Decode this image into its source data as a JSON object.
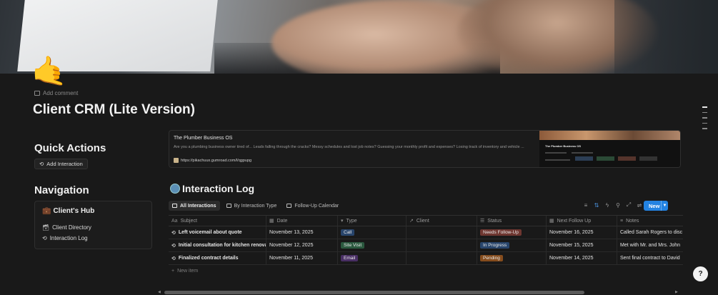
{
  "page": {
    "icon": "🤙",
    "add_comment": "Add comment",
    "title": "Client CRM (Lite Version)"
  },
  "quick_actions": {
    "heading": "Quick Actions",
    "button_label": "Add Interaction"
  },
  "navigation": {
    "heading": "Navigation",
    "hub_icon": "💼",
    "hub_label": "Client's Hub",
    "items": [
      {
        "label": "Client Directory",
        "icon": "briefcase-icon"
      },
      {
        "label": "Interaction Log",
        "icon": "history-icon"
      }
    ]
  },
  "bookmark": {
    "title": "The Plumber Business OS",
    "description": "Are you a plumbing business owner tired of... Leads falling through the cracks? Messy schedules and lost job notes? Guessing your monthly profit and expenses? Losing track of inventory and vehicle ...",
    "url": "https://pikachuux.gumroad.com/l/qgpupg",
    "thumb_title": "The Plumber Business OS"
  },
  "interaction_log": {
    "title": "Interaction Log",
    "views": [
      {
        "label": "All Interactions",
        "active": true
      },
      {
        "label": "By Interaction Type",
        "active": false
      },
      {
        "label": "Follow-Up Calendar",
        "active": false
      }
    ],
    "new_button": "New",
    "columns": [
      {
        "label": "Subject",
        "icon": "Aa"
      },
      {
        "label": "Date",
        "icon": "▦"
      },
      {
        "label": "Type",
        "icon": "▾"
      },
      {
        "label": "Client",
        "icon": "↗"
      },
      {
        "label": "Status",
        "icon": "☰"
      },
      {
        "label": "Next Follow Up",
        "icon": "▦"
      },
      {
        "label": "Notes",
        "icon": "≡"
      }
    ],
    "rows": [
      {
        "subject": "Left voicemail about quote",
        "date": "November 13, 2025",
        "type": "Call",
        "type_color": "#28456c",
        "client": "",
        "status": "Needs Follow-Up",
        "status_color": "#6e3630",
        "next": "November 16, 2025",
        "notes": "Called Sarah Rogers to disc"
      },
      {
        "subject": "Initial consultation for kitchen renovation",
        "date": "November 12, 2025",
        "type": "Site Visit",
        "type_color": "#2b593f",
        "client": "",
        "status": "In Progress",
        "status_color": "#28456c",
        "next": "November 15, 2025",
        "notes": "Met with Mr. and Mrs. John"
      },
      {
        "subject": "Finalized contract details",
        "date": "November 11, 2025",
        "type": "Email",
        "type_color": "#492f64",
        "client": "",
        "status": "Pending",
        "status_color": "#854c1d",
        "next": "November 14, 2025",
        "notes": "Sent final contract to David"
      }
    ],
    "new_item": "New item"
  }
}
